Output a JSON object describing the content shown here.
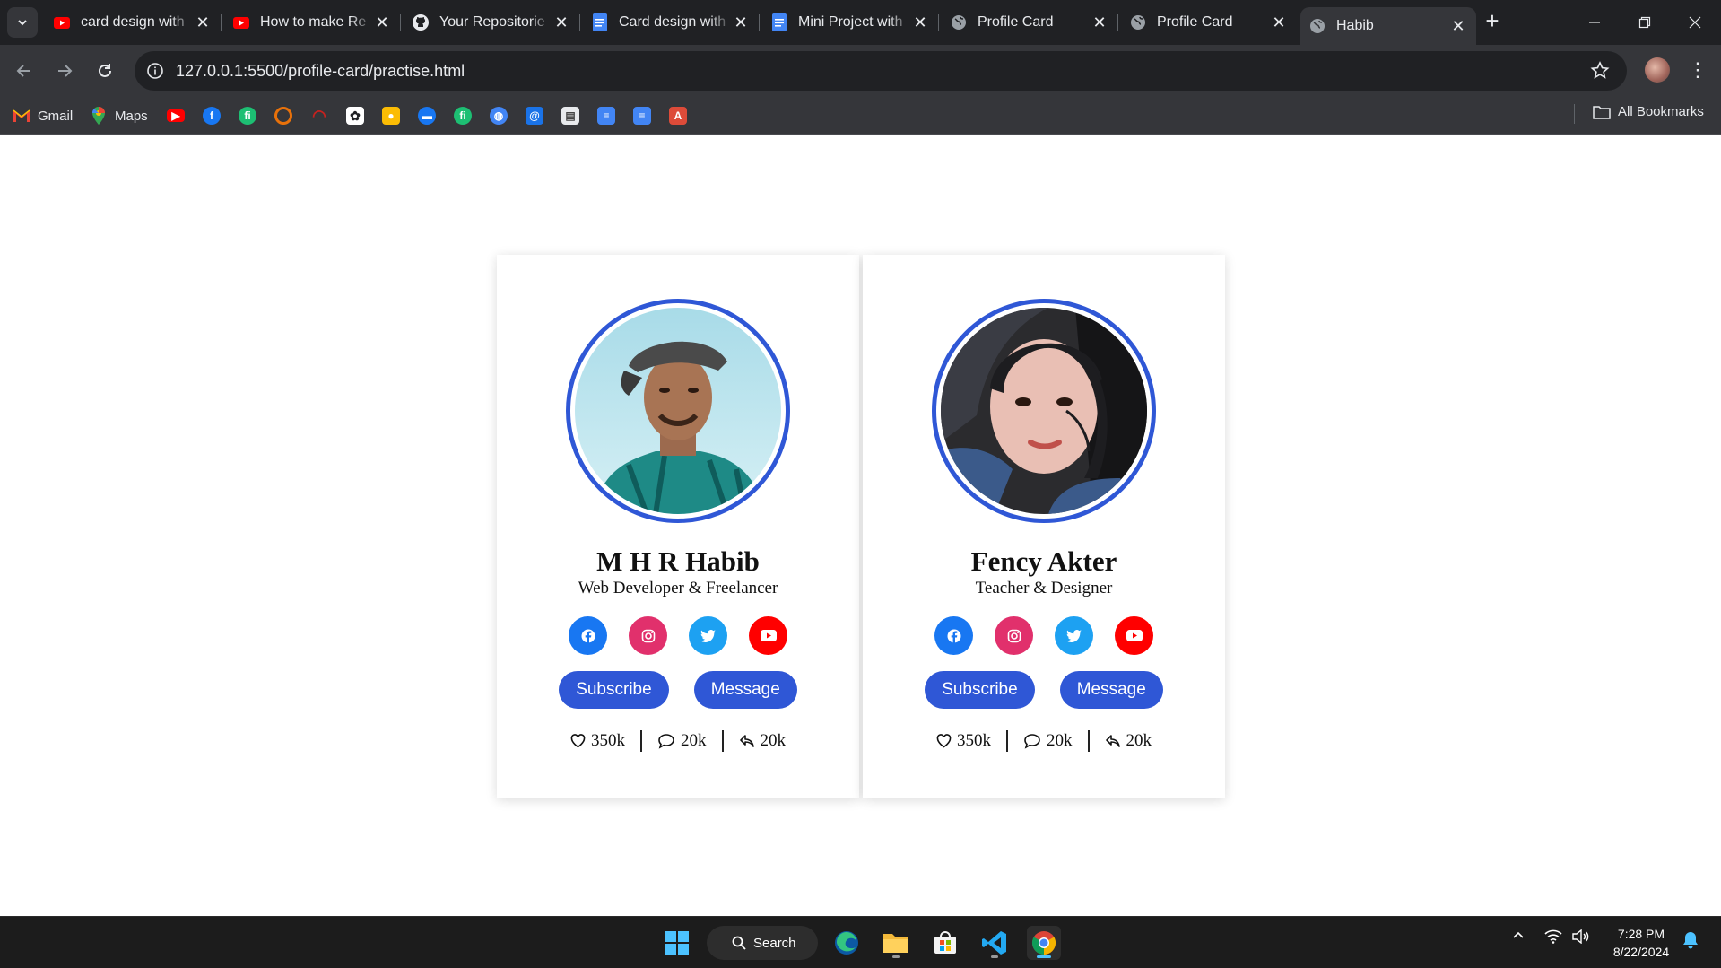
{
  "browser": {
    "tabs": [
      {
        "title": "card design with",
        "icon": "youtube-icon"
      },
      {
        "title": "How to make Re",
        "icon": "youtube-icon"
      },
      {
        "title": "Your Repositorie",
        "icon": "github-icon"
      },
      {
        "title": "Card design with",
        "icon": "google-docs-icon"
      },
      {
        "title": "Mini Project with",
        "icon": "google-docs-icon"
      },
      {
        "title": "Profile Card",
        "icon": "globe-icon"
      },
      {
        "title": "Profile Card",
        "icon": "globe-icon"
      },
      {
        "title": "Habib",
        "icon": "globe-icon",
        "active": true
      }
    ],
    "url": "127.0.0.1:5500/profile-card/practise.html",
    "bookmarks": [
      {
        "label": "Gmail",
        "icon": "gmail-icon"
      },
      {
        "label": "Maps",
        "icon": "maps-icon"
      }
    ],
    "all_bookmarks_label": "All Bookmarks"
  },
  "cards": [
    {
      "name": "M H R Habib",
      "role": "Web Developer & Freelancer",
      "subscribe_label": "Subscribe",
      "message_label": "Message",
      "likes": "350k",
      "comments": "20k",
      "shares": "20k"
    },
    {
      "name": "Fency Akter",
      "role": "Teacher & Designer",
      "subscribe_label": "Subscribe",
      "message_label": "Message",
      "likes": "350k",
      "comments": "20k",
      "shares": "20k"
    }
  ],
  "colors": {
    "accent": "#2f57d6",
    "facebook": "#1877f2",
    "instagram": "#e1306c",
    "twitter": "#1da1f2",
    "youtube": "#ff0000"
  },
  "taskbar": {
    "search_label": "Search",
    "time": "7:28 PM",
    "date": "8/22/2024"
  }
}
